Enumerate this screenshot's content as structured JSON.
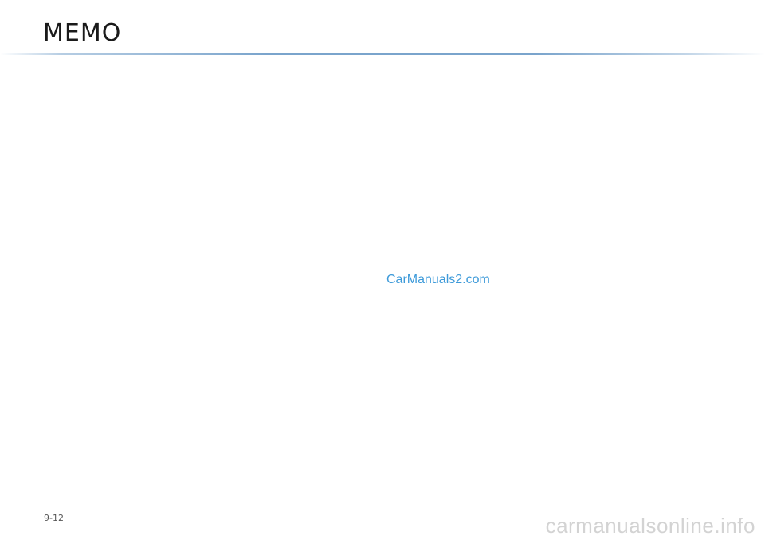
{
  "header": {
    "title": "MEMO",
    "rule_color": "#7aa4cc"
  },
  "watermark": {
    "center_text": "CarManuals2.com",
    "center_color": "#3d9ad9",
    "footer_text": "carmanualsonline.info",
    "footer_color": "#d3d3d3"
  },
  "footer": {
    "page_number": "9-12"
  }
}
